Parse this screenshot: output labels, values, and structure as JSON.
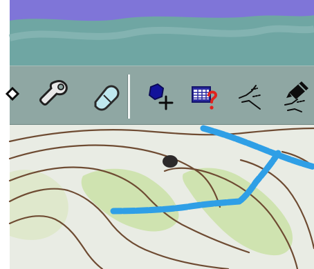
{
  "toolbar": {
    "tools": [
      {
        "icon": "pan-arrow-icon",
        "kind": "tool"
      },
      {
        "icon": "wrench-icon",
        "kind": "tool"
      },
      {
        "icon": "eraser-icon",
        "kind": "tool"
      },
      {
        "icon": "add-point-icon",
        "kind": "tool"
      },
      {
        "icon": "table-query-icon",
        "kind": "tool"
      },
      {
        "icon": "line-split-icon",
        "kind": "tool"
      },
      {
        "icon": "edit-line-icon",
        "kind": "tool"
      }
    ]
  },
  "colors": {
    "toolbar_bg": "#8fa7a3",
    "route_blue": "#2f9fe6",
    "sky_purple": "#7f75d8",
    "forest_teal": "#6fa6a3",
    "terrain_light": "#e9ece4",
    "terrain_green": "#cfe3b0",
    "contour_brown": "#6e4b32"
  }
}
